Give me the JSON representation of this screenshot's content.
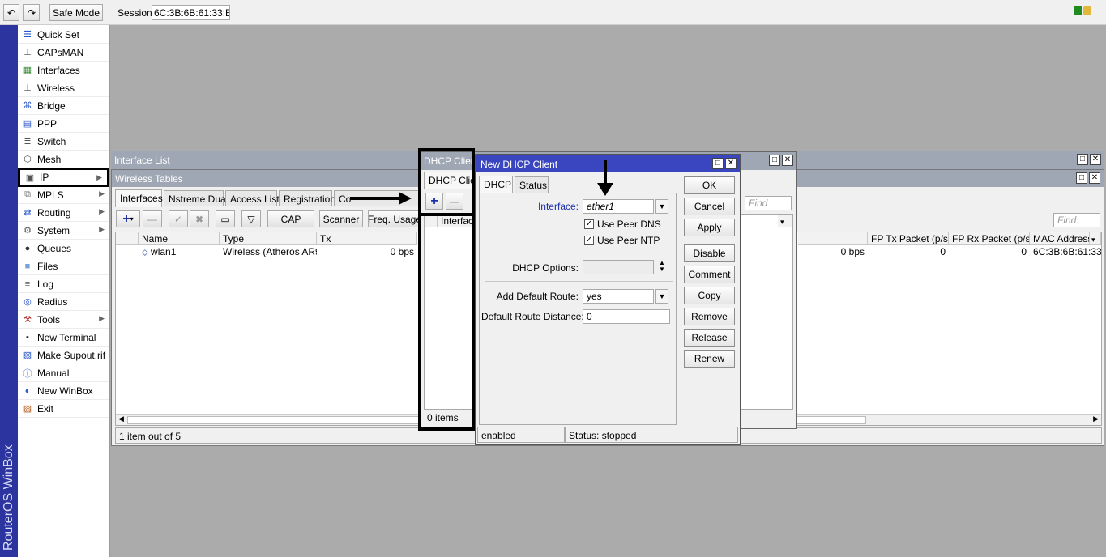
{
  "toolbar": {
    "undo_icon": "undo-icon",
    "redo_icon": "redo-icon",
    "safe_mode": "Safe Mode",
    "session_label": "Session:",
    "session_value": "6C:3B:6B:61:33:EC"
  },
  "brand": "RouterOS WinBox",
  "menu": [
    {
      "label": "Quick Set",
      "icon": "quick-set-icon",
      "sub": false
    },
    {
      "label": "CAPsMAN",
      "icon": "antenna-icon",
      "sub": false
    },
    {
      "label": "Interfaces",
      "icon": "interfaces-icon",
      "sub": false
    },
    {
      "label": "Wireless",
      "icon": "antenna-icon",
      "sub": false
    },
    {
      "label": "Bridge",
      "icon": "bridge-icon",
      "sub": false
    },
    {
      "label": "PPP",
      "icon": "ppp-icon",
      "sub": false
    },
    {
      "label": "Switch",
      "icon": "switch-icon",
      "sub": false
    },
    {
      "label": "Mesh",
      "icon": "mesh-icon",
      "sub": false
    },
    {
      "label": "IP",
      "icon": "ip-icon",
      "sub": true
    },
    {
      "label": "MPLS",
      "icon": "mpls-icon",
      "sub": true
    },
    {
      "label": "Routing",
      "icon": "routing-icon",
      "sub": true
    },
    {
      "label": "System",
      "icon": "gear-icon",
      "sub": true
    },
    {
      "label": "Queues",
      "icon": "queues-icon",
      "sub": false
    },
    {
      "label": "Files",
      "icon": "folder-icon",
      "sub": false
    },
    {
      "label": "Log",
      "icon": "log-icon",
      "sub": false
    },
    {
      "label": "Radius",
      "icon": "radius-icon",
      "sub": false
    },
    {
      "label": "Tools",
      "icon": "tools-icon",
      "sub": true
    },
    {
      "label": "New Terminal",
      "icon": "terminal-icon",
      "sub": false
    },
    {
      "label": "Make Supout.rif",
      "icon": "supout-icon",
      "sub": false
    },
    {
      "label": "Manual",
      "icon": "manual-icon",
      "sub": false
    },
    {
      "label": "New WinBox",
      "icon": "winbox-icon",
      "sub": false
    },
    {
      "label": "Exit",
      "icon": "exit-icon",
      "sub": false
    }
  ],
  "interface_list": {
    "title": "Interface List"
  },
  "wireless_tables": {
    "title": "Wireless Tables",
    "tabs": [
      "Interfaces",
      "Nstreme Dual",
      "Access List",
      "Registration",
      "Co"
    ],
    "buttons": {
      "cap": "CAP",
      "scanner": "Scanner",
      "freq": "Freq. Usage"
    },
    "find_placeholder": "Find",
    "columns": [
      "Name",
      "Type",
      "Tx",
      "FP Tx Packet (p/s)",
      "FP Rx Packet (p/s)",
      "MAC Address"
    ],
    "rows": [
      {
        "name": "wlan1",
        "type": "Wireless (Atheros AR9...",
        "tx": "0 bps",
        "rx": "0 bps",
        "fp_tx": "0",
        "fp_rx": "0",
        "mac": "6C:3B:6B:61:33:EC"
      }
    ],
    "status": "1 item out of 5"
  },
  "dhcp_client": {
    "title": "DHCP Client",
    "tab": "DHCP Client",
    "column": "Interface",
    "status": "0 items",
    "find_placeholder": "Find"
  },
  "dialog": {
    "title": "New DHCP Client",
    "tabs": [
      "DHCP",
      "Status"
    ],
    "interface_label": "Interface:",
    "interface_value": "ether1",
    "use_peer_dns": "Use Peer DNS",
    "use_peer_ntp": "Use Peer NTP",
    "dhcp_options_label": "DHCP Options:",
    "add_default_route_label": "Add Default Route:",
    "add_default_route_value": "yes",
    "default_route_distance_label": "Default Route Distance:",
    "default_route_distance_value": "0",
    "buttons": [
      "OK",
      "Cancel",
      "Apply",
      "Disable",
      "Comment",
      "Copy",
      "Remove",
      "Release",
      "Renew"
    ],
    "status_left": "enabled",
    "status_right": "Status: stopped"
  }
}
